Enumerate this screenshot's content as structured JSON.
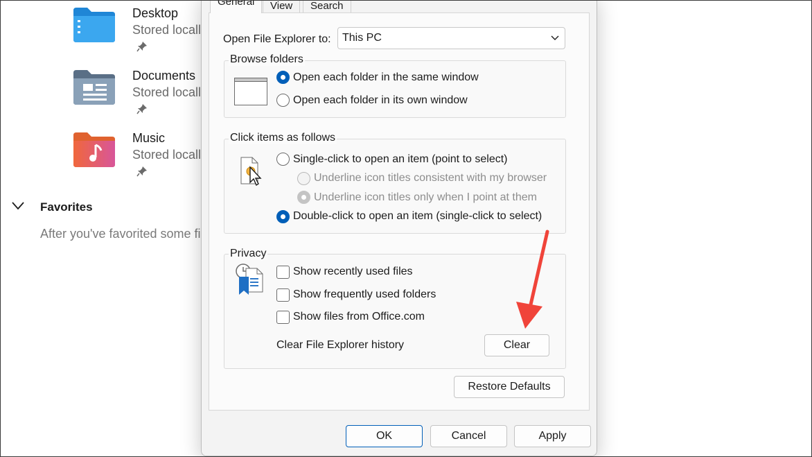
{
  "background": {
    "items": [
      {
        "name": "Desktop",
        "subtitle": "Stored locally"
      },
      {
        "name": "Documents",
        "subtitle": "Stored locally"
      },
      {
        "name": "Music",
        "subtitle": "Stored locally"
      }
    ],
    "favorites": {
      "title": "Favorites",
      "description": "After you've favorited some fi"
    }
  },
  "dialog": {
    "tabs": [
      "General",
      "View",
      "Search"
    ],
    "open_label": "Open File Explorer to:",
    "open_value": "This PC",
    "browse": {
      "title": "Browse folders",
      "option1": "Open each folder in the same window",
      "option2": "Open each folder in its own window"
    },
    "click": {
      "title": "Click items as follows",
      "single": "Single-click to open an item (point to select)",
      "underline1": "Underline icon titles consistent with my browser",
      "underline2": "Underline icon titles only when I point at them",
      "double": "Double-click to open an item (single-click to select)"
    },
    "privacy": {
      "title": "Privacy",
      "recent": "Show recently used files",
      "frequent": "Show frequently used folders",
      "office": "Show files from Office.com",
      "history": "Clear File Explorer history",
      "clear": "Clear"
    },
    "restore": "Restore Defaults",
    "ok": "OK",
    "cancel": "Cancel",
    "apply": "Apply"
  },
  "colors": {
    "accent": "#005fb8",
    "arrow": "#f0443a"
  }
}
